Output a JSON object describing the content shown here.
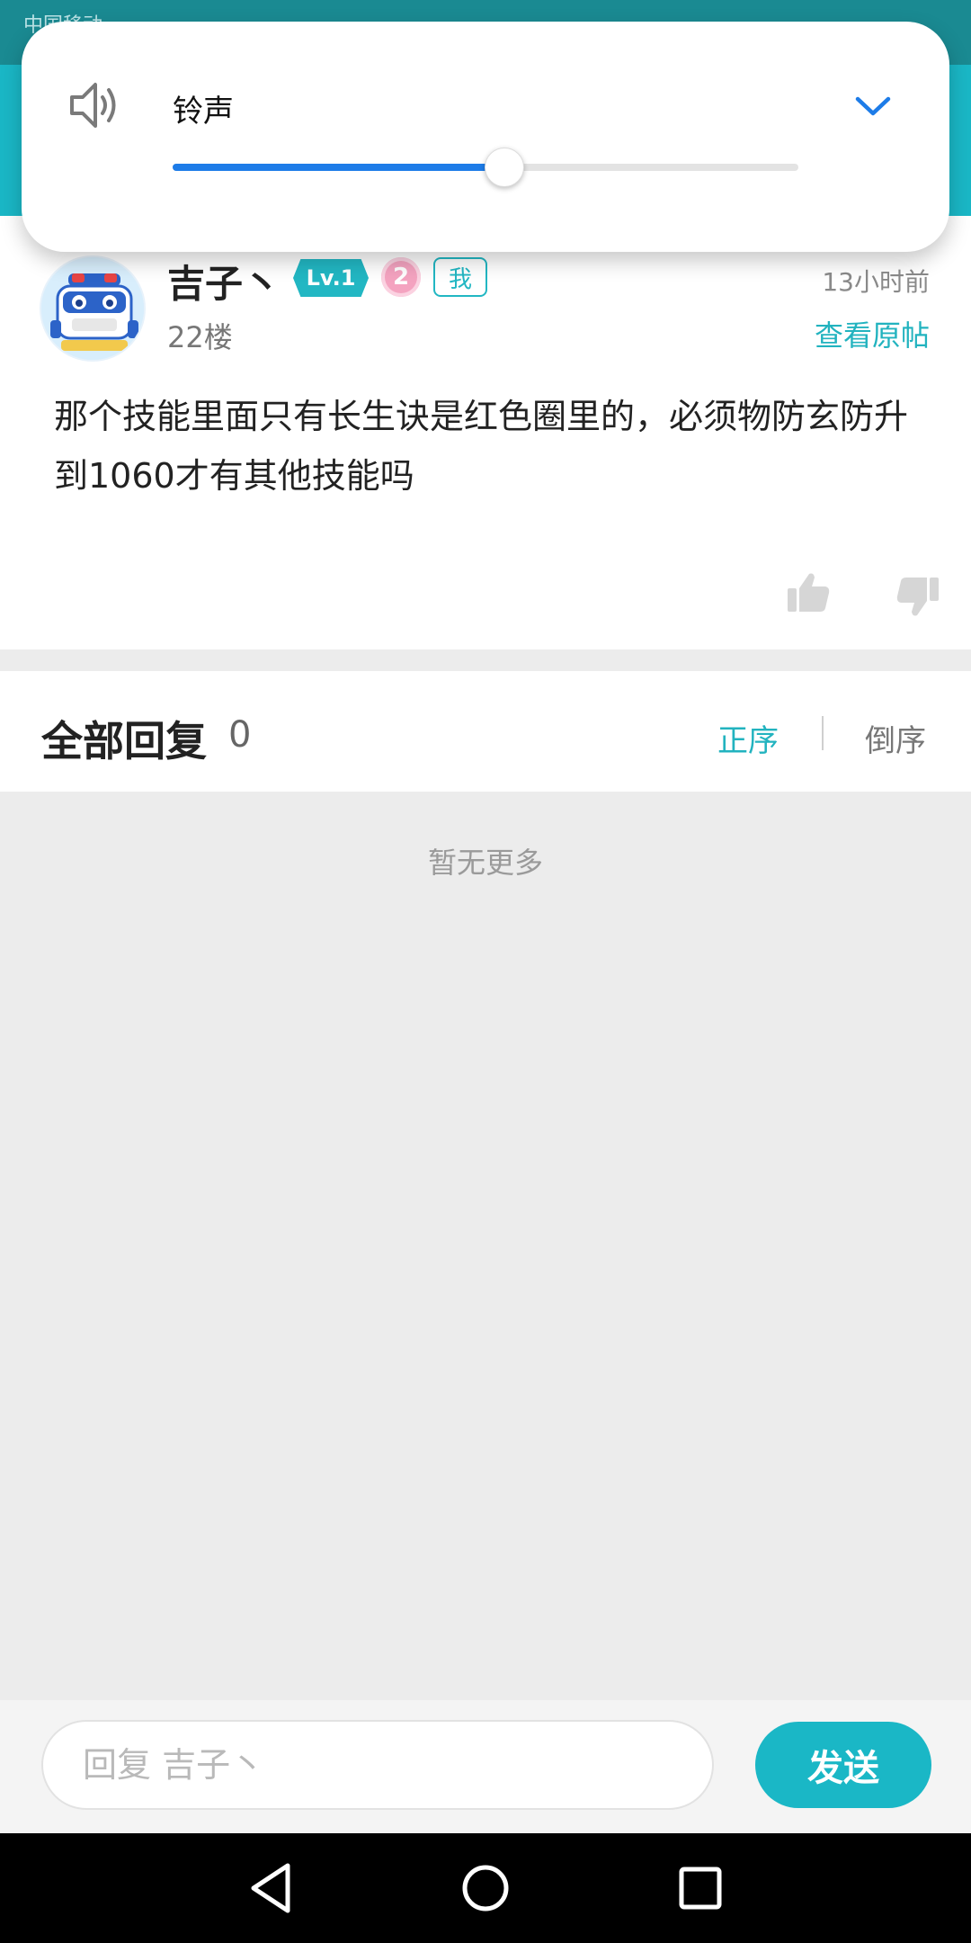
{
  "status_bar": {
    "carrier": "中国移动"
  },
  "volume": {
    "label": "铃声",
    "level_fraction": 0.53,
    "icon": "speaker-icon",
    "expand_icon": "chevron-down-icon",
    "accent": "#1d7ce8"
  },
  "post": {
    "username": "吉子丶",
    "level_badge": "Lv.1",
    "medal_number": "2",
    "me_badge": "我",
    "time": "13小时前",
    "floor": "22楼",
    "view_original": "查看原帖",
    "content": "那个技能里面只有长生诀是红色圈里的，必须物防玄防升到1060才有其他技能吗"
  },
  "replies": {
    "title": "全部回复",
    "count": "0",
    "sort_asc": "正序",
    "sort_desc": "倒序",
    "empty_text": "暂无更多"
  },
  "reply_bar": {
    "placeholder": "回复 吉子丶",
    "send_label": "发送"
  },
  "colors": {
    "brand_teal": "#1ab7c6",
    "link_teal": "#22b3bf"
  }
}
